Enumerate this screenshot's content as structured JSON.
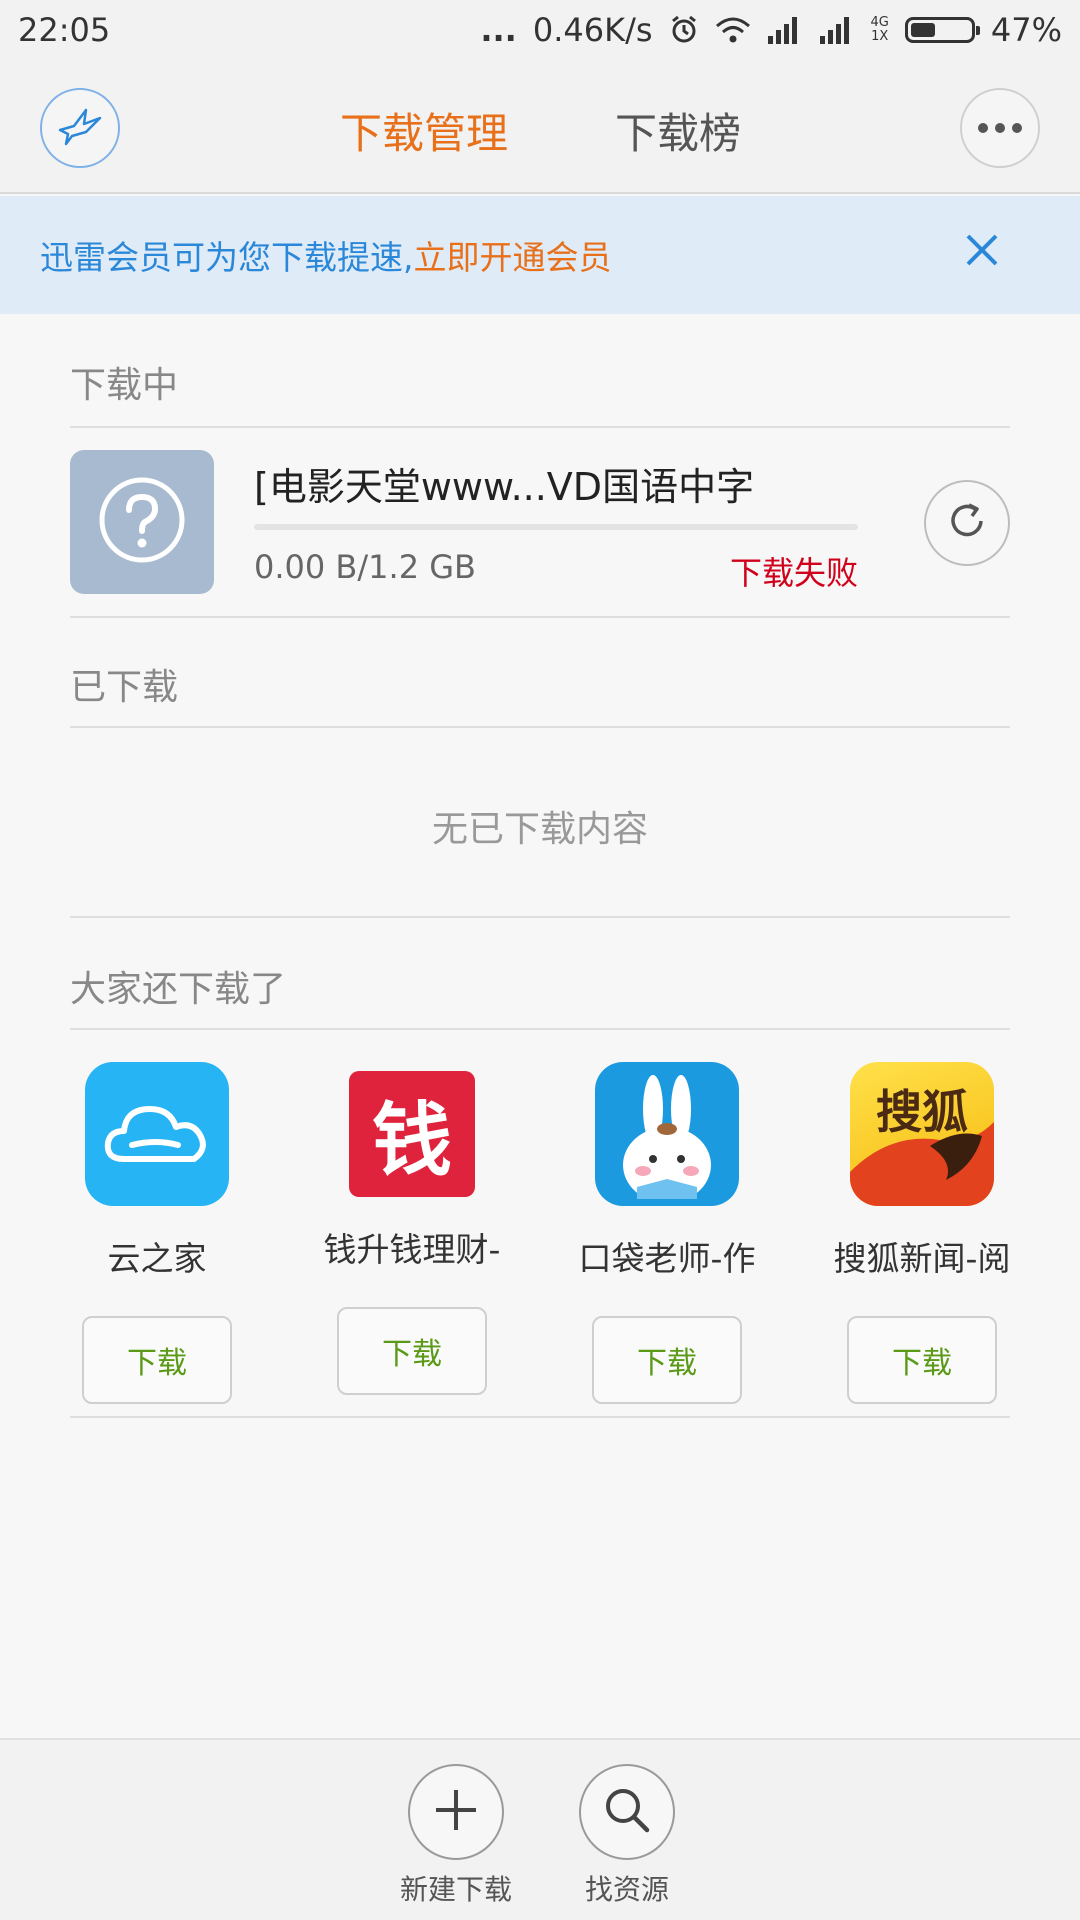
{
  "status_bar": {
    "time": "22:05",
    "dots": "...",
    "speed": "0.46K/s",
    "network_top": "4G",
    "network_bottom": "1X",
    "battery_percent": "47%",
    "battery_level": 0.47
  },
  "header": {
    "tab_active": "下载管理",
    "tab_inactive": "下载榜"
  },
  "banner": {
    "text": "迅雷会员可为您下载提速,",
    "link": "立即开通会员"
  },
  "downloading": {
    "section_title": "下载中",
    "item": {
      "name": "[电影天堂www...VD国语中字",
      "size": "0.00 B/1.2 GB",
      "status": "下载失败",
      "progress": 0.0
    }
  },
  "downloaded": {
    "section_title": "已下载",
    "empty_text": "无已下载内容"
  },
  "recommended": {
    "section_title": "大家还下载了",
    "apps": [
      {
        "name": "云之家",
        "button": "下载",
        "icon": "cloud-icon",
        "color": "#26b4f5"
      },
      {
        "name": "钱升钱理财-",
        "button": "下载",
        "icon_text": "钱",
        "icon": "money-icon",
        "color": "#e0233c"
      },
      {
        "name": "口袋老师-作",
        "button": "下载",
        "icon": "rabbit-icon",
        "color": "#1c9ae0"
      },
      {
        "name": "搜狐新闻-阅",
        "button": "下载",
        "icon_text": "搜狐",
        "icon": "sohu-icon",
        "color": "#f5c518"
      }
    ]
  },
  "bottom_bar": {
    "new_download": "新建下载",
    "find_resource": "找资源"
  },
  "colors": {
    "accent_orange": "#e8701a",
    "accent_blue": "#2b88d9",
    "error_red": "#d0021b",
    "button_green": "#5a9a16"
  }
}
